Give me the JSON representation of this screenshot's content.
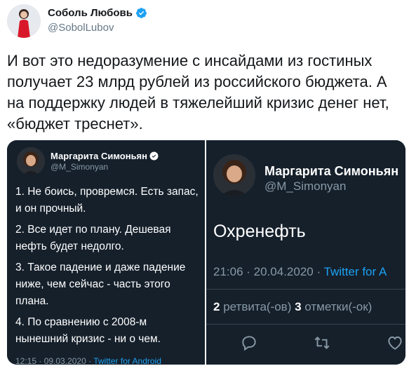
{
  "author": {
    "name": "Соболь Любовь",
    "handle": "@SobolLubov"
  },
  "tweet_text": "И вот это недоразумение с инсайдами из гостиных получает 23 млрд рублей из российского бюджета. А на поддержку людей в тяжелейший кризис денег нет, «бюджет треснет».",
  "media_left": {
    "name": "Маргарита Симоньян",
    "handle": "@M_Simonyan",
    "items": [
      "1. Не боись, провремся. Есть запас, и он прочный.",
      "2. Все идет по плану. Дешевая нефть будет недолго.",
      "3. Такое падение и даже падение ниже, чем сейчас - часть этого плана.",
      "4. По сравнению с 2008-м нынешний кризис - ни о чем."
    ],
    "footer_time": "12:15 · 09.03.2020 · ",
    "footer_source": "Twitter for Android"
  },
  "media_right": {
    "name": "Маргарита Симоньян",
    "handle": "@M_Simonyan",
    "text": "Охренефть",
    "time": "21:06 · 20.04.2020 · ",
    "source": "Twitter for A",
    "retweets_count": "2",
    "retweets_label": " ретвита(-ов)  ",
    "likes_count": "3",
    "likes_label": " отметки(-ок)"
  },
  "colors": {
    "verified": "#1da1f2",
    "dark_bg": "#15202b",
    "link": "#1da1f2"
  },
  "icons": [
    "verified-icon",
    "reply-icon",
    "retweet-icon",
    "like-icon"
  ]
}
